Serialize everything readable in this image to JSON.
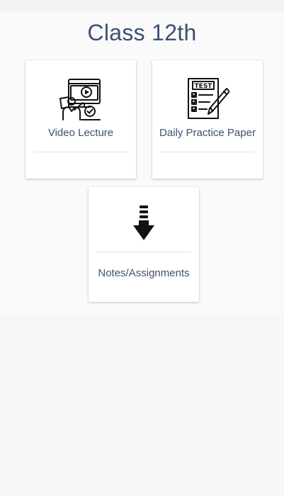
{
  "page": {
    "title": "Class 12th"
  },
  "cards": {
    "video": {
      "label": "Video Lecture",
      "icon": "video-lecture-icon"
    },
    "dpp": {
      "label": "Daily Practice Paper",
      "icon": "test-paper-icon",
      "icon_text": "TEST"
    },
    "notes": {
      "label": "Notes/Assignments",
      "icon": "download-arrow-icon"
    }
  },
  "colors": {
    "title_text": "#3d5073",
    "background": "#f7f7f7",
    "card": "#ffffff"
  }
}
